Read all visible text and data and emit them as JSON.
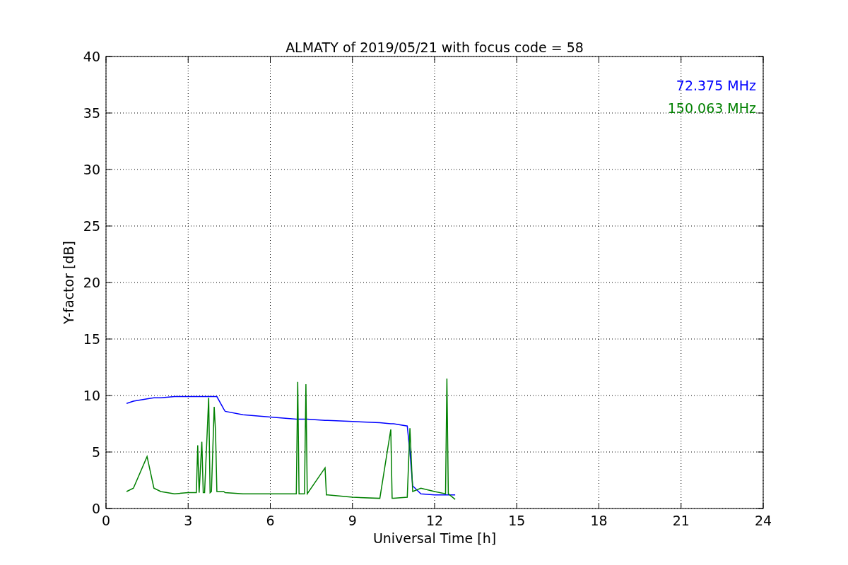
{
  "figure": {
    "chart_data": {
      "type": "line",
      "title": "ALMATY of 2019/05/21 with focus code = 58",
      "xlabel": "Universal Time [h]",
      "ylabel": "Y-factor [dB]",
      "x": [
        0.75,
        1.0,
        1.5,
        1.75,
        2.0,
        2.5,
        3.0,
        3.3,
        3.35,
        3.4,
        3.5,
        3.55,
        3.6,
        3.75,
        3.8,
        3.85,
        3.95,
        4.0,
        4.05,
        4.3,
        4.35,
        5,
        6,
        6.95,
        7.0,
        7.05,
        7.25,
        7.3,
        7.35,
        8.0,
        8.05,
        8.1,
        9,
        10,
        10.4,
        10.45,
        10.5,
        11,
        11.1,
        11.2,
        11.5,
        12,
        12.4,
        12.45,
        12.5,
        12.75
      ],
      "series": [
        {
          "name": "72.375 MHz",
          "color": "#0000ff",
          "values": [
            9.3,
            9.5,
            9.7,
            9.8,
            9.8,
            9.9,
            9.9,
            9.9,
            9.9,
            9.9,
            9.9,
            9.9,
            9.9,
            9.9,
            9.9,
            9.9,
            9.9,
            9.9,
            9.9,
            8.8,
            8.6,
            8.3,
            8.1,
            7.9,
            7.9,
            7.9,
            7.9,
            7.9,
            7.9,
            7.8,
            7.8,
            7.8,
            7.7,
            7.6,
            7.5,
            7.5,
            7.5,
            7.3,
            5,
            2,
            1.3,
            1.2,
            1.2,
            1.2,
            1.2,
            1.2
          ]
        },
        {
          "name": "150.063 MHz",
          "color": "#008000",
          "values": [
            1.5,
            1.8,
            4.6,
            1.8,
            1.5,
            1.3,
            1.4,
            1.4,
            5.6,
            1.4,
            5.9,
            1.4,
            1.4,
            9.8,
            1.4,
            1.5,
            9,
            6.8,
            1.5,
            1.5,
            1.4,
            1.3,
            1.3,
            1.3,
            11.2,
            1.3,
            1.3,
            11,
            1.3,
            3.6,
            1.2,
            1.2,
            1.0,
            0.9,
            7.0,
            0.9,
            0.9,
            1.0,
            7.1,
            1.5,
            1.8,
            1.5,
            1.3,
            11.5,
            1.3,
            0.8
          ]
        }
      ],
      "xlim": [
        0,
        24
      ],
      "ylim": [
        0,
        40
      ],
      "xticks": [
        0,
        3,
        6,
        9,
        12,
        15,
        18,
        21,
        24
      ],
      "yticks": [
        0,
        5,
        10,
        15,
        20,
        25,
        30,
        35,
        40
      ],
      "grid": true
    }
  }
}
